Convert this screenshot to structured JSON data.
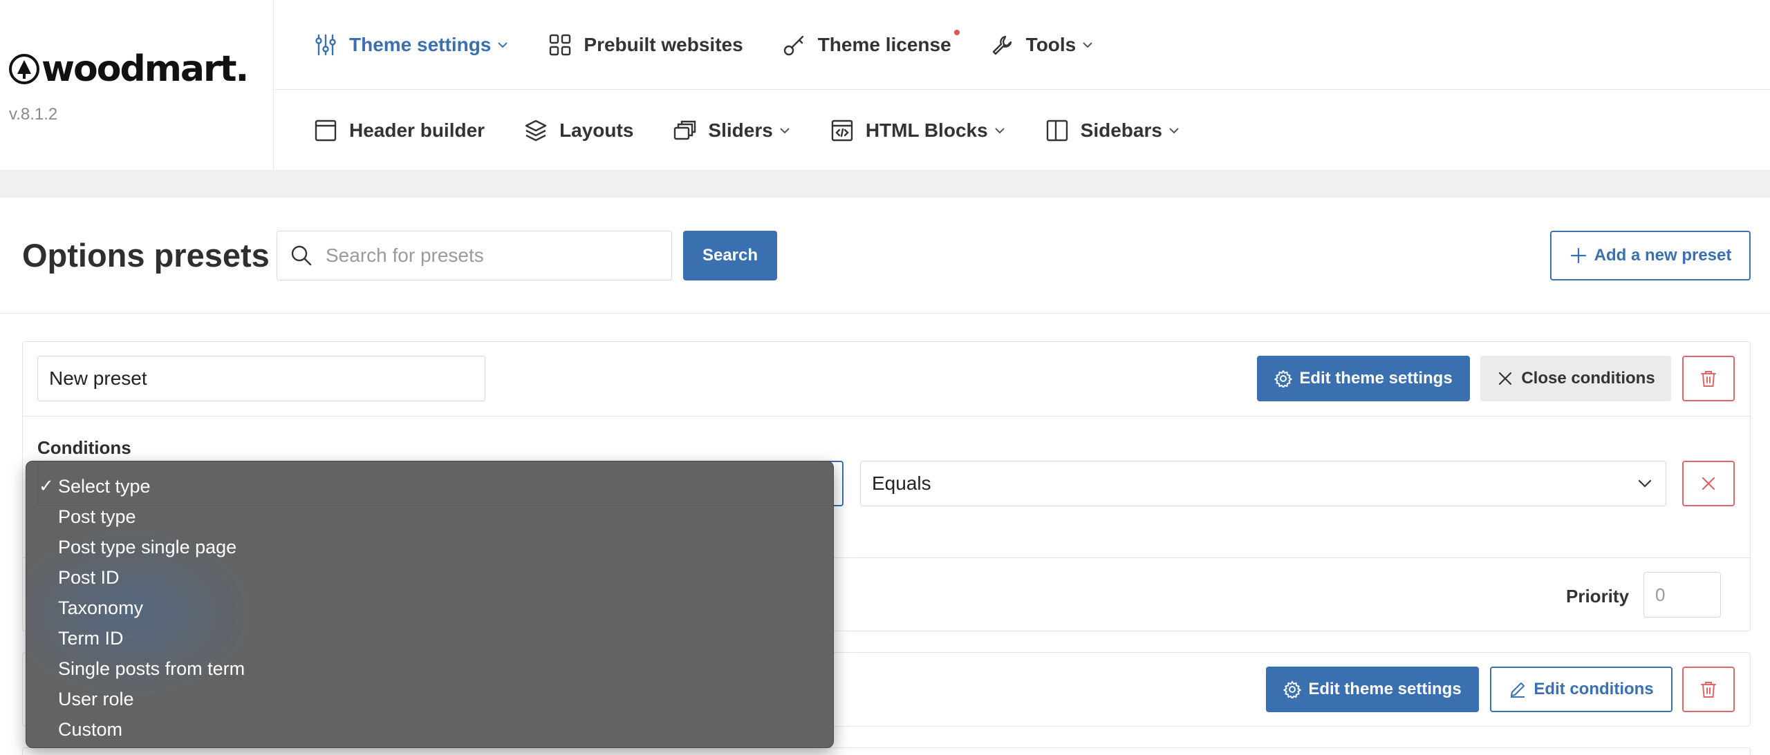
{
  "brand": {
    "logo_text": "woodmart.",
    "version": "v.8.1.2"
  },
  "nav_primary": [
    {
      "label": "Theme settings",
      "icon": "sliders-icon",
      "active": true,
      "chevron": true
    },
    {
      "label": "Prebuilt websites",
      "icon": "grid-icon",
      "active": false,
      "chevron": false
    },
    {
      "label": "Theme license",
      "icon": "key-icon",
      "active": false,
      "chevron": false,
      "notification_dot": true
    },
    {
      "label": "Tools",
      "icon": "wrench-icon",
      "active": false,
      "chevron": true
    }
  ],
  "nav_secondary": [
    {
      "label": "Header builder",
      "icon": "layout-icon",
      "chevron": false
    },
    {
      "label": "Layouts",
      "icon": "layers-icon",
      "chevron": false
    },
    {
      "label": "Sliders",
      "icon": "slides-icon",
      "chevron": true
    },
    {
      "label": "HTML Blocks",
      "icon": "code-block-icon",
      "chevron": true
    },
    {
      "label": "Sidebars",
      "icon": "sidebar-icon",
      "chevron": true
    }
  ],
  "page": {
    "title": "Options presets",
    "search_placeholder": "Search for presets",
    "search_button": "Search",
    "add_button": "Add a new preset"
  },
  "preset1": {
    "name_value": "New preset",
    "edit_button": "Edit theme settings",
    "close_button": "Close conditions",
    "conditions_label": "Conditions",
    "comparison_value": "Equals",
    "priority_label": "Priority",
    "priority_placeholder": "0"
  },
  "preset2": {
    "edit_button": "Edit theme settings",
    "edit_conditions_button": "Edit conditions"
  },
  "type_dropdown": {
    "selected": "Select type",
    "options": [
      "Select type",
      "Post type",
      "Post type single page",
      "Post ID",
      "Taxonomy",
      "Term ID",
      "Single posts from term",
      "User role",
      "Custom"
    ]
  },
  "colors": {
    "accent": "#3a6fb0",
    "danger": "#e06666",
    "dropdown_bg": "#606060"
  }
}
